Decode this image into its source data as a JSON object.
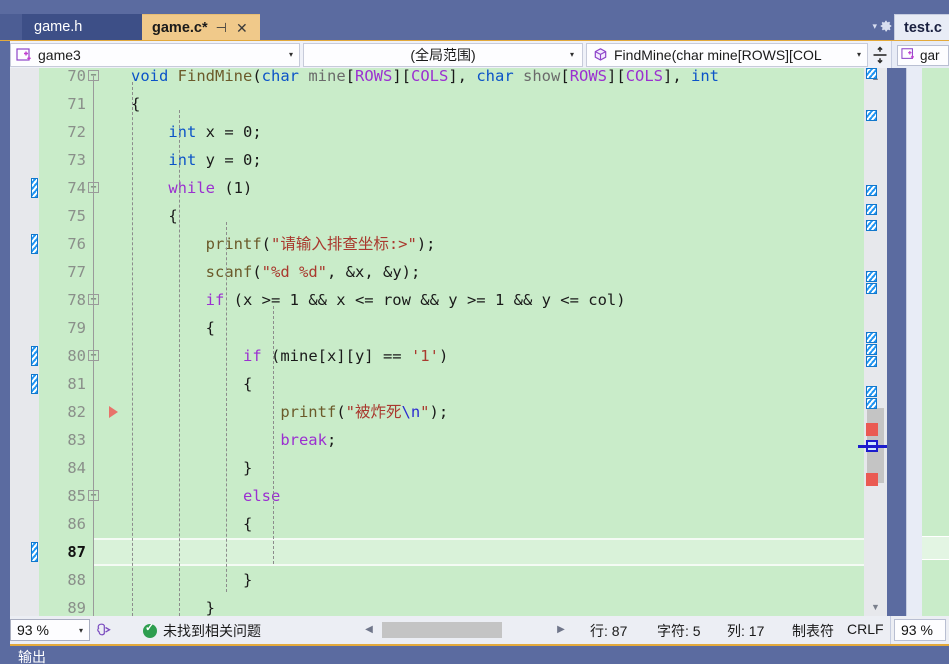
{
  "window": {
    "accent_orange": "#e3a93b",
    "chrome_blue": "#5b6ba0",
    "editor_bg_green": "#c9ecc9"
  },
  "tabstrip": {
    "inactive_tab": {
      "label": "game.h"
    },
    "active_tab": {
      "label": "game.c*",
      "pin_icon": "pin-icon",
      "pin_glyph": "⊣",
      "close_icon": "close-icon",
      "close_glyph": "✕"
    },
    "overflow_chevron": "▾",
    "settings_icon": "gear-icon",
    "docked_right_tab": {
      "label": "test.c"
    }
  },
  "navbar": {
    "project_combo": {
      "icon": "project-icon",
      "value": "game3",
      "arrow": "▾"
    },
    "scope_combo": {
      "value": "(全局范围)",
      "arrow": "▾"
    },
    "member_combo": {
      "icon": "method-cube-icon",
      "value": "FindMine(char mine[ROWS][COL",
      "arrow": "▾"
    },
    "split_view_icon": "split-window-icon",
    "right_pane_combo": {
      "icon": "project-icon",
      "value": "gar"
    }
  },
  "editor": {
    "lines": [
      {
        "number": "70",
        "partial_top": true,
        "outline": "collapse-minus",
        "tokens": [
          {
            "t": "void ",
            "c": "ty"
          },
          {
            "t": "FindMine",
            "c": "fn"
          },
          {
            "t": "(",
            "c": "pl"
          },
          {
            "t": "char ",
            "c": "ty"
          },
          {
            "t": "mine",
            "c": "pn"
          },
          {
            "t": "[",
            "c": "pl"
          },
          {
            "t": "ROWS",
            "c": "mc"
          },
          {
            "t": "][",
            "c": "pl"
          },
          {
            "t": "COLS",
            "c": "mc"
          },
          {
            "t": "], ",
            "c": "pl"
          },
          {
            "t": "char ",
            "c": "ty"
          },
          {
            "t": "show",
            "c": "pn"
          },
          {
            "t": "[",
            "c": "pl"
          },
          {
            "t": "ROWS",
            "c": "mc"
          },
          {
            "t": "][",
            "c": "pl"
          },
          {
            "t": "COLS",
            "c": "mc"
          },
          {
            "t": "], ",
            "c": "pl"
          },
          {
            "t": "int",
            "c": "ty"
          }
        ]
      },
      {
        "number": "71",
        "tokens": [
          {
            "t": "{",
            "c": "pl"
          }
        ]
      },
      {
        "number": "72",
        "tokens": [
          {
            "t": "    ",
            "c": "pl"
          },
          {
            "t": "int",
            "c": "ty"
          },
          {
            "t": " x = 0;",
            "c": "pl"
          }
        ]
      },
      {
        "number": "73",
        "tokens": [
          {
            "t": "    ",
            "c": "pl"
          },
          {
            "t": "int",
            "c": "ty"
          },
          {
            "t": " y = 0;",
            "c": "pl"
          }
        ]
      },
      {
        "number": "74",
        "change": "unsaved",
        "outline": "collapse-minus",
        "tokens": [
          {
            "t": "    ",
            "c": "pl"
          },
          {
            "t": "while",
            "c": "k"
          },
          {
            "t": " (1)",
            "c": "pl"
          }
        ]
      },
      {
        "number": "75",
        "tokens": [
          {
            "t": "    {",
            "c": "pl"
          }
        ]
      },
      {
        "number": "76",
        "change": "unsaved",
        "tokens": [
          {
            "t": "        ",
            "c": "pl"
          },
          {
            "t": "printf",
            "c": "fn"
          },
          {
            "t": "(",
            "c": "pl"
          },
          {
            "t": "\"请输入排查坐标:>\"",
            "c": "st"
          },
          {
            "t": ");",
            "c": "pl"
          }
        ]
      },
      {
        "number": "77",
        "tokens": [
          {
            "t": "        ",
            "c": "pl"
          },
          {
            "t": "scanf",
            "c": "fn"
          },
          {
            "t": "(",
            "c": "pl"
          },
          {
            "t": "\"%d %d\"",
            "c": "st"
          },
          {
            "t": ", &x, &y);",
            "c": "pl"
          }
        ]
      },
      {
        "number": "78",
        "outline": "collapse-minus",
        "tokens": [
          {
            "t": "        ",
            "c": "pl"
          },
          {
            "t": "if",
            "c": "k"
          },
          {
            "t": " (x >= 1 && x <= row && y >= 1 && y <= col)",
            "c": "pl"
          }
        ]
      },
      {
        "number": "79",
        "tokens": [
          {
            "t": "        {",
            "c": "pl"
          }
        ]
      },
      {
        "number": "80",
        "change": "unsaved",
        "outline": "collapse-minus",
        "tokens": [
          {
            "t": "            ",
            "c": "pl"
          },
          {
            "t": "if",
            "c": "k"
          },
          {
            "t": " (mine[x][y] == ",
            "c": "pl"
          },
          {
            "t": "'1'",
            "c": "st"
          },
          {
            "t": ")",
            "c": "pl"
          }
        ]
      },
      {
        "number": "81",
        "change": "unsaved",
        "tokens": [
          {
            "t": "            {",
            "c": "pl"
          }
        ]
      },
      {
        "number": "82",
        "marker": "trace-point",
        "tokens": [
          {
            "t": "                ",
            "c": "pl"
          },
          {
            "t": "printf",
            "c": "fn"
          },
          {
            "t": "(",
            "c": "pl"
          },
          {
            "t": "\"被炸死",
            "c": "st"
          },
          {
            "t": "\\n",
            "c": "esc"
          },
          {
            "t": "\"",
            "c": "st"
          },
          {
            "t": ");",
            "c": "pl"
          }
        ]
      },
      {
        "number": "83",
        "tokens": [
          {
            "t": "                ",
            "c": "pl"
          },
          {
            "t": "break",
            "c": "k"
          },
          {
            "t": ";",
            "c": "pl"
          }
        ]
      },
      {
        "number": "84",
        "tokens": [
          {
            "t": "            }",
            "c": "pl"
          }
        ]
      },
      {
        "number": "85",
        "outline": "collapse-minus",
        "tokens": [
          {
            "t": "            ",
            "c": "pl"
          },
          {
            "t": "else",
            "c": "k"
          }
        ]
      },
      {
        "number": "86",
        "tokens": [
          {
            "t": "            {",
            "c": "pl"
          }
        ]
      },
      {
        "number": "87",
        "current": true,
        "change": "unsaved",
        "tokens": [
          {
            "t": "",
            "c": "pl"
          }
        ]
      },
      {
        "number": "88",
        "tokens": [
          {
            "t": "            }",
            "c": "pl"
          }
        ]
      },
      {
        "number": "89",
        "tokens": [
          {
            "t": "        }",
            "c": "pl"
          }
        ]
      }
    ]
  },
  "scrollbar": {
    "up_arrow": "▲",
    "down_arrow": "▼"
  },
  "statusbar": {
    "zoom_combo": {
      "value": "93 %",
      "arrow": "▾"
    },
    "intellicode_icon": "intellicode-brain-icon",
    "status_icon": "check-ok-icon",
    "status_text": "未找到相关问题",
    "hscroll_left_arrow": "◀",
    "hscroll_right_arrow": "▶",
    "line_label": "行: 87",
    "char_label": "字符: 5",
    "col_label": "列: 17",
    "tab_label": "制表符",
    "eol_label": "CRLF",
    "zoom_right": "93 %"
  },
  "bottom_dock": {
    "label": "输出"
  }
}
